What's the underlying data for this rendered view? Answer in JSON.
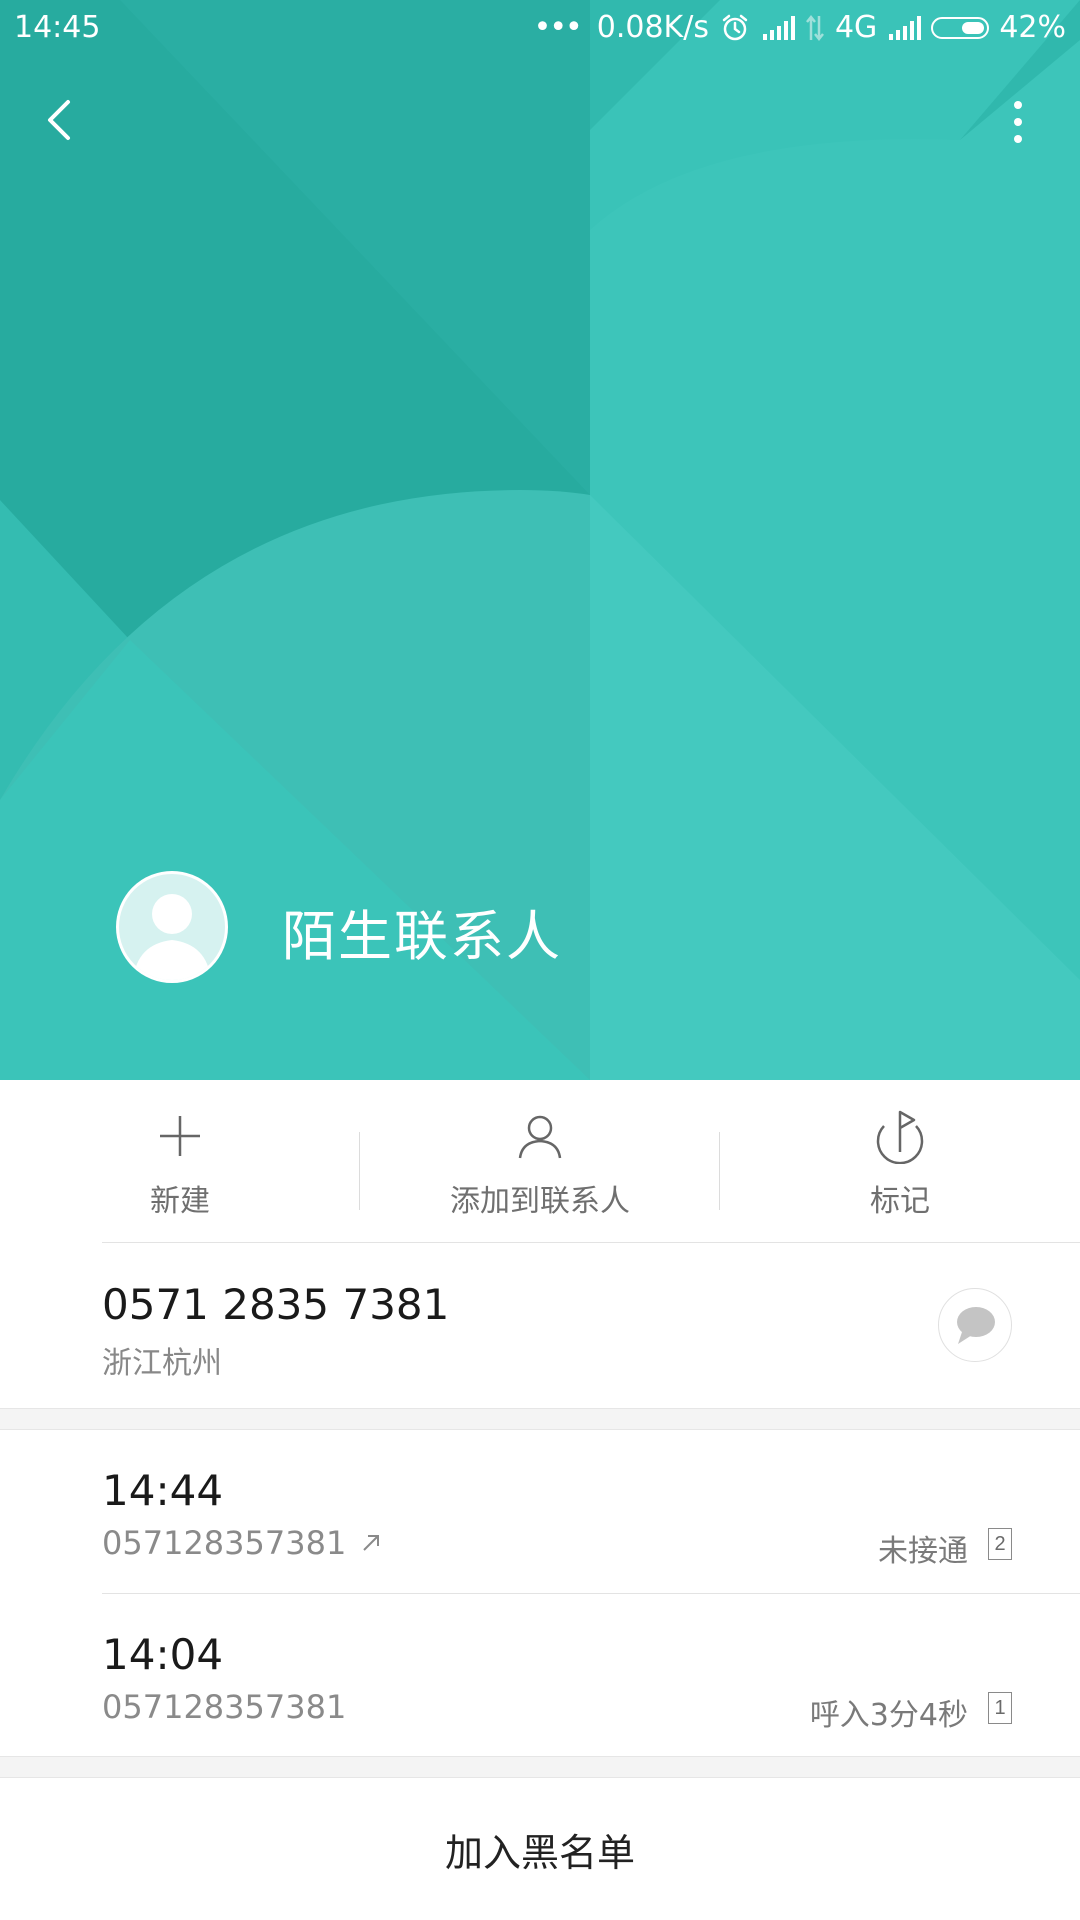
{
  "status_bar": {
    "time": "14:45",
    "dots": "•••",
    "net_speed": "0.08K/s",
    "network": "4G",
    "battery": "42%",
    "icons": [
      "alarm-icon",
      "signal-icon",
      "data-arrows-icon",
      "signal-icon",
      "battery-icon"
    ]
  },
  "header": {
    "back_icon": "chevron-left-icon",
    "menu_icon": "more-vertical-icon",
    "contact_name": "陌生联系人",
    "avatar_icon": "person-silhouette-icon",
    "background_color": "#35bdb2"
  },
  "actions": [
    {
      "label": "新建",
      "icon": "plus-icon"
    },
    {
      "label": "添加到联系人",
      "icon": "person-outline-icon"
    },
    {
      "label": "标记",
      "icon": "flag-icon"
    }
  ],
  "phone": {
    "number": "0571 2835 7381",
    "location": "浙江杭州",
    "message_icon": "chat-bubble-icon"
  },
  "calls": [
    {
      "time": "14:44",
      "number": "057128357381",
      "direction_icon": "outgoing-arrow-icon",
      "status": "未接通",
      "count": "2"
    },
    {
      "time": "14:04",
      "number": "057128357381",
      "status": "呼入3分4秒",
      "count": "1"
    }
  ],
  "blacklist_label": "加入黑名单"
}
